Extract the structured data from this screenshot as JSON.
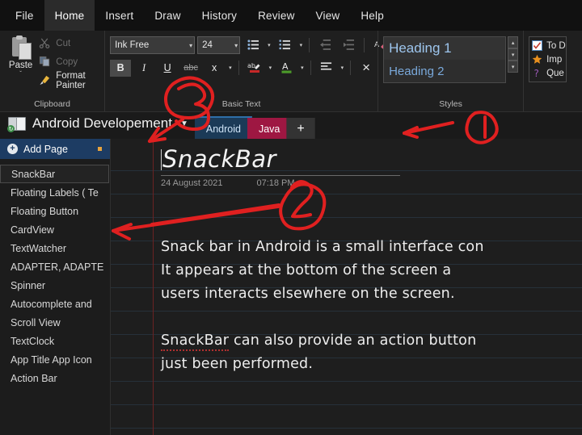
{
  "menubar": {
    "items": [
      {
        "label": "File",
        "active": false
      },
      {
        "label": "Home",
        "active": true
      },
      {
        "label": "Insert",
        "active": false
      },
      {
        "label": "Draw",
        "active": false
      },
      {
        "label": "History",
        "active": false
      },
      {
        "label": "Review",
        "active": false
      },
      {
        "label": "View",
        "active": false
      },
      {
        "label": "Help",
        "active": false
      }
    ]
  },
  "ribbon": {
    "clipboard": {
      "label": "Clipboard",
      "paste": "Paste",
      "paste_caret": "ˇ",
      "cut": "Cut",
      "copy": "Copy",
      "format_painter": "Format Painter"
    },
    "basic_text": {
      "label": "Basic Text",
      "font_name": "Ink Free",
      "font_size": "24",
      "bold": "B",
      "italic": "I",
      "underline": "U",
      "strikethrough": "abc",
      "subscript": "x",
      "clear_formatting": "×"
    },
    "styles": {
      "label": "Styles",
      "items": [
        "Heading 1",
        "Heading 2"
      ]
    },
    "tags": {
      "items": [
        "To D",
        "Imp",
        "Que"
      ]
    }
  },
  "notebook": {
    "name": "Android Developement",
    "caret": "▼",
    "sections": [
      {
        "label": "Android",
        "color": "#1b3a57",
        "active": true
      },
      {
        "label": "Java",
        "color": "#9e1742",
        "active": false
      }
    ],
    "add_section": "+"
  },
  "sidebar": {
    "add_page": "Add Page",
    "pages": [
      {
        "label": "SnackBar",
        "selected": true
      },
      {
        "label": "Floating Labels ( Te",
        "selected": false
      },
      {
        "label": "Floating Button",
        "selected": false
      },
      {
        "label": "CardView",
        "selected": false
      },
      {
        "label": "TextWatcher",
        "selected": false
      },
      {
        "label": "ADAPTER, ADAPTE",
        "selected": false
      },
      {
        "label": "Spinner",
        "selected": false
      },
      {
        "label": "Autocomplete and",
        "selected": false
      },
      {
        "label": "Scroll View",
        "selected": false
      },
      {
        "label": "TextClock",
        "selected": false
      },
      {
        "label": "App Title App Icon",
        "selected": false
      },
      {
        "label": "Action Bar",
        "selected": false
      }
    ]
  },
  "page": {
    "title": "SnackBar",
    "date": "24 August 2021",
    "time": "07:18 PM",
    "paragraphs": [
      [
        "Snack bar in Android is a small interface con",
        "It appears at the bottom of the screen a",
        "users interacts  elsewhere on the screen."
      ],
      [
        "SnackBar can also provide an action button",
        "just been performed."
      ]
    ],
    "misspelled_word": "SnackBar"
  },
  "annotations": {
    "marks": [
      "1",
      "2",
      "3"
    ],
    "color": "#e02020"
  }
}
